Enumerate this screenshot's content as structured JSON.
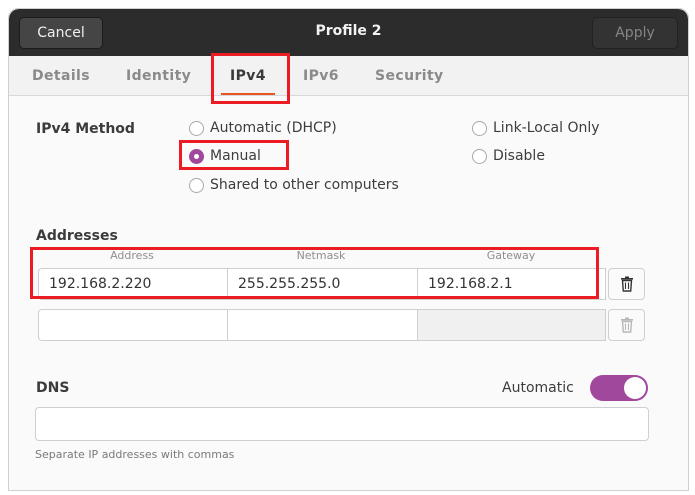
{
  "header": {
    "cancel": "Cancel",
    "title": "Profile 2",
    "apply": "Apply"
  },
  "tabs": [
    "Details",
    "Identity",
    "IPv4",
    "IPv6",
    "Security"
  ],
  "active_tab": "IPv4",
  "ipv4_method": {
    "label": "IPv4 Method",
    "options": {
      "automatic": "Automatic (DHCP)",
      "link_local": "Link-Local Only",
      "manual": "Manual",
      "disable": "Disable",
      "shared": "Shared to other computers"
    },
    "selected": "Manual"
  },
  "addresses": {
    "label": "Addresses",
    "columns": [
      "Address",
      "Netmask",
      "Gateway"
    ],
    "rows": [
      [
        "192.168.2.220",
        "255.255.255.0",
        "192.168.2.1"
      ],
      [
        "",
        "",
        ""
      ]
    ]
  },
  "dns": {
    "label": "DNS",
    "automatic_label": "Automatic",
    "automatic_on": true,
    "value": "",
    "hint": "Separate IP addresses with commas"
  },
  "colors": {
    "accent": "#a0489c",
    "tab_indicator": "#e95420",
    "highlight": "#ec1c24",
    "header_bg": "#2c2c2c"
  },
  "icons": {
    "delete": "trash-icon"
  }
}
